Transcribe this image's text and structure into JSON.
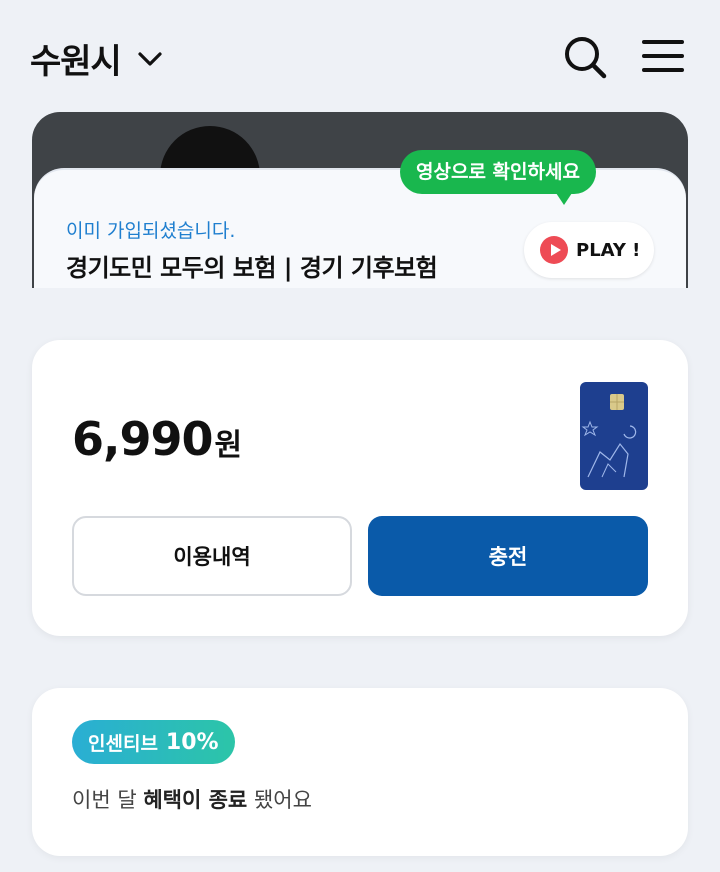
{
  "header": {
    "city": "수원시"
  },
  "banner": {
    "joined_text": "이미 가입되셨습니다.",
    "title": "경기도민 모두의 보험 | 경기 기후보험",
    "tooltip": "영상으로 확인하세요",
    "play_label": "PLAY !"
  },
  "balance": {
    "amount": "6,990",
    "unit": "원",
    "history_label": "이용내역",
    "charge_label": "충전"
  },
  "incentive": {
    "label": "인센티브",
    "rate": "10%",
    "text_1": "이번 달",
    "text_bold": "혜택이 종료",
    "text_2": "됐어요"
  },
  "colors": {
    "background": "#eef1f6",
    "accent_blue": "#0a5aa9",
    "tooltip_green": "#19b74e",
    "link_blue": "#1f7fcf",
    "play_red": "#ee4b55"
  },
  "icons": [
    "chevron-down-icon",
    "search-icon",
    "menu-icon",
    "play-icon",
    "gyeonggi-card-image"
  ]
}
